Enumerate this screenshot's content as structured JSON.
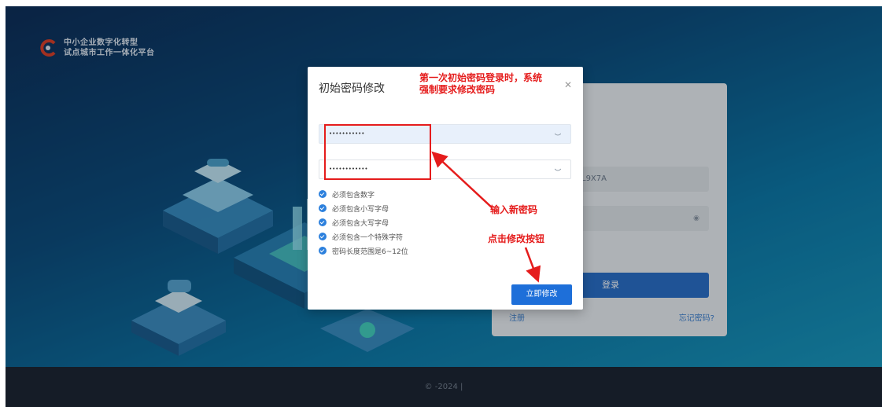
{
  "brand": {
    "line1": "中小企业数字化转型",
    "line2": "试点城市工作一体化平台",
    "icon": "brand-logo-icon"
  },
  "login_card": {
    "captcha_value": "L9X7A",
    "login_button": "登录",
    "register_link": "注册",
    "forgot_link": "忘记密码?"
  },
  "modal": {
    "title": "初始密码修改",
    "close_icon": "close-icon",
    "new_password_value": "•••••••••••",
    "confirm_password_value": "••••••••••••",
    "eye_icon": "eye-off-icon",
    "rules": [
      "必须包含数字",
      "必须包含小写字母",
      "必须包含大写字母",
      "必须包含一个特殊字符",
      "密码长度范围是6~12位"
    ],
    "submit_label": "立即修改"
  },
  "annotations": {
    "top_note_line1": "第一次初始密码登录时，系统",
    "top_note_line2": "强制要求修改密码",
    "input_note": "输入新密码",
    "button_note": "点击修改按钮"
  },
  "footer": {
    "text": "© -2024 |"
  },
  "colors": {
    "accent": "#1e6fd9",
    "annotation": "#e51c1c",
    "footer_bg": "#151c27"
  }
}
